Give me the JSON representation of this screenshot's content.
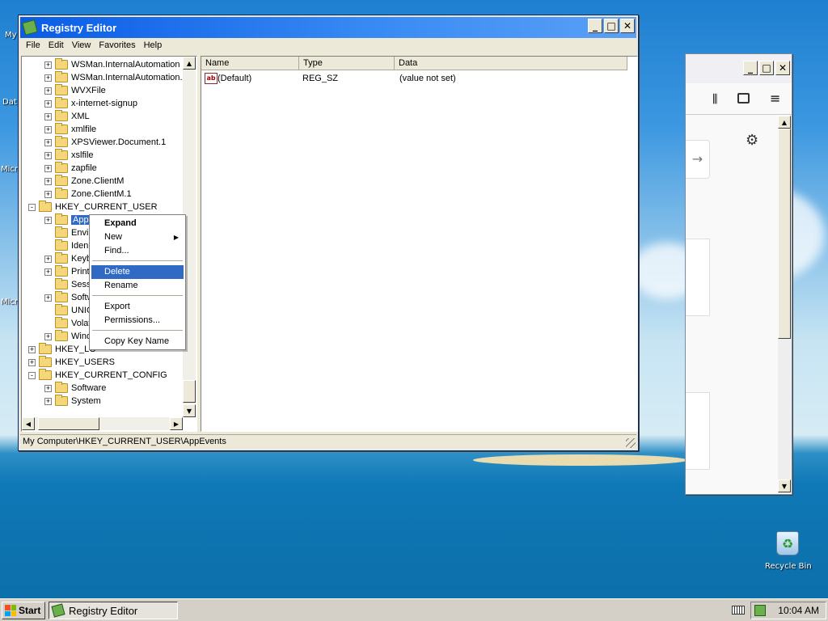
{
  "desktop": {
    "icons": [
      "My",
      "Dat",
      "Micr",
      "Micr",
      "Recycle Bin"
    ]
  },
  "window": {
    "title": "Registry Editor",
    "menu": [
      "File",
      "Edit",
      "View",
      "Favorites",
      "Help"
    ],
    "tree": [
      {
        "label": "WSMan.InternalAutomation",
        "pm": "+"
      },
      {
        "label": "WSMan.InternalAutomation.",
        "pm": "+"
      },
      {
        "label": "WVXFile",
        "pm": "+"
      },
      {
        "label": "x-internet-signup",
        "pm": "+"
      },
      {
        "label": "XML",
        "pm": "+"
      },
      {
        "label": "xmlfile",
        "pm": "+"
      },
      {
        "label": "XPSViewer.Document.1",
        "pm": "+"
      },
      {
        "label": "xslfile",
        "pm": "+"
      },
      {
        "label": "zapfile",
        "pm": "+"
      },
      {
        "label": "Zone.ClientM",
        "pm": "+"
      },
      {
        "label": "Zone.ClientM.1",
        "pm": "+"
      },
      {
        "label": "HKEY_CURRENT_USER",
        "pm": "-"
      },
      {
        "label": "AppE",
        "pm": "+"
      },
      {
        "label": "Envir",
        "pm": ""
      },
      {
        "label": "Iden",
        "pm": ""
      },
      {
        "label": "Keyb",
        "pm": "+"
      },
      {
        "label": "Print",
        "pm": "+"
      },
      {
        "label": "Sess",
        "pm": ""
      },
      {
        "label": "Softw",
        "pm": "+"
      },
      {
        "label": "UNIC",
        "pm": ""
      },
      {
        "label": "Volat",
        "pm": ""
      },
      {
        "label": "Wind",
        "pm": "+"
      },
      {
        "label": "HKEY_LO",
        "pm": "+"
      },
      {
        "label": "HKEY_USERS",
        "pm": "+"
      },
      {
        "label": "HKEY_CURRENT_CONFIG",
        "pm": "-"
      },
      {
        "label": "Software",
        "pm": "+"
      },
      {
        "label": "System",
        "pm": "+"
      }
    ],
    "columns": [
      "Name",
      "Type",
      "Data"
    ],
    "values": [
      {
        "name": "(Default)",
        "type": "REG_SZ",
        "data": "(value not set)"
      }
    ],
    "status": "My Computer\\HKEY_CURRENT_USER\\AppEvents"
  },
  "context_menu": {
    "items": [
      "Expand",
      "New",
      "Find...",
      "Delete",
      "Rename",
      "Export",
      "Permissions...",
      "Copy Key Name"
    ],
    "highlighted": "Delete"
  },
  "taskbar": {
    "start": "Start",
    "task": "Registry Editor",
    "clock": "10:04 AM"
  },
  "colors": {
    "titlebar": "#0a5ce6",
    "highlight": "#316ac5"
  }
}
